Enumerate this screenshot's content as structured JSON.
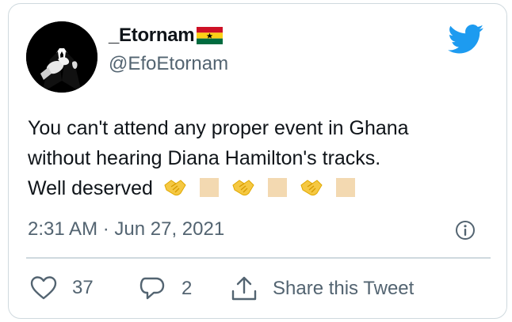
{
  "user": {
    "display_name": "_Etornam",
    "flag_icon": "ghana-flag-icon",
    "handle": "@EfoEtornam",
    "avatar_icon": "suited-figure-avatar"
  },
  "tweet": {
    "line1": "You can't attend any proper event in Ghana",
    "line2": "without hearing Diana Hamilton's tracks.",
    "line3": "Well deserved",
    "emojis": [
      "handshake-emoji",
      "skin-tone-swatch",
      "handshake-emoji",
      "skin-tone-swatch",
      "handshake-emoji",
      "skin-tone-swatch"
    ]
  },
  "meta": {
    "timestamp": "2:31 AM · Jun 27, 2021"
  },
  "actions": {
    "likes": "37",
    "replies": "2",
    "share_label": "Share this Tweet"
  },
  "colors": {
    "twitter_blue": "#1d9bf0",
    "text_primary": "#0f1419",
    "text_secondary": "#536471",
    "border": "#cfd9de",
    "emoji_yellow": "#f5c842",
    "skin_tone": "#f3d9b1"
  }
}
